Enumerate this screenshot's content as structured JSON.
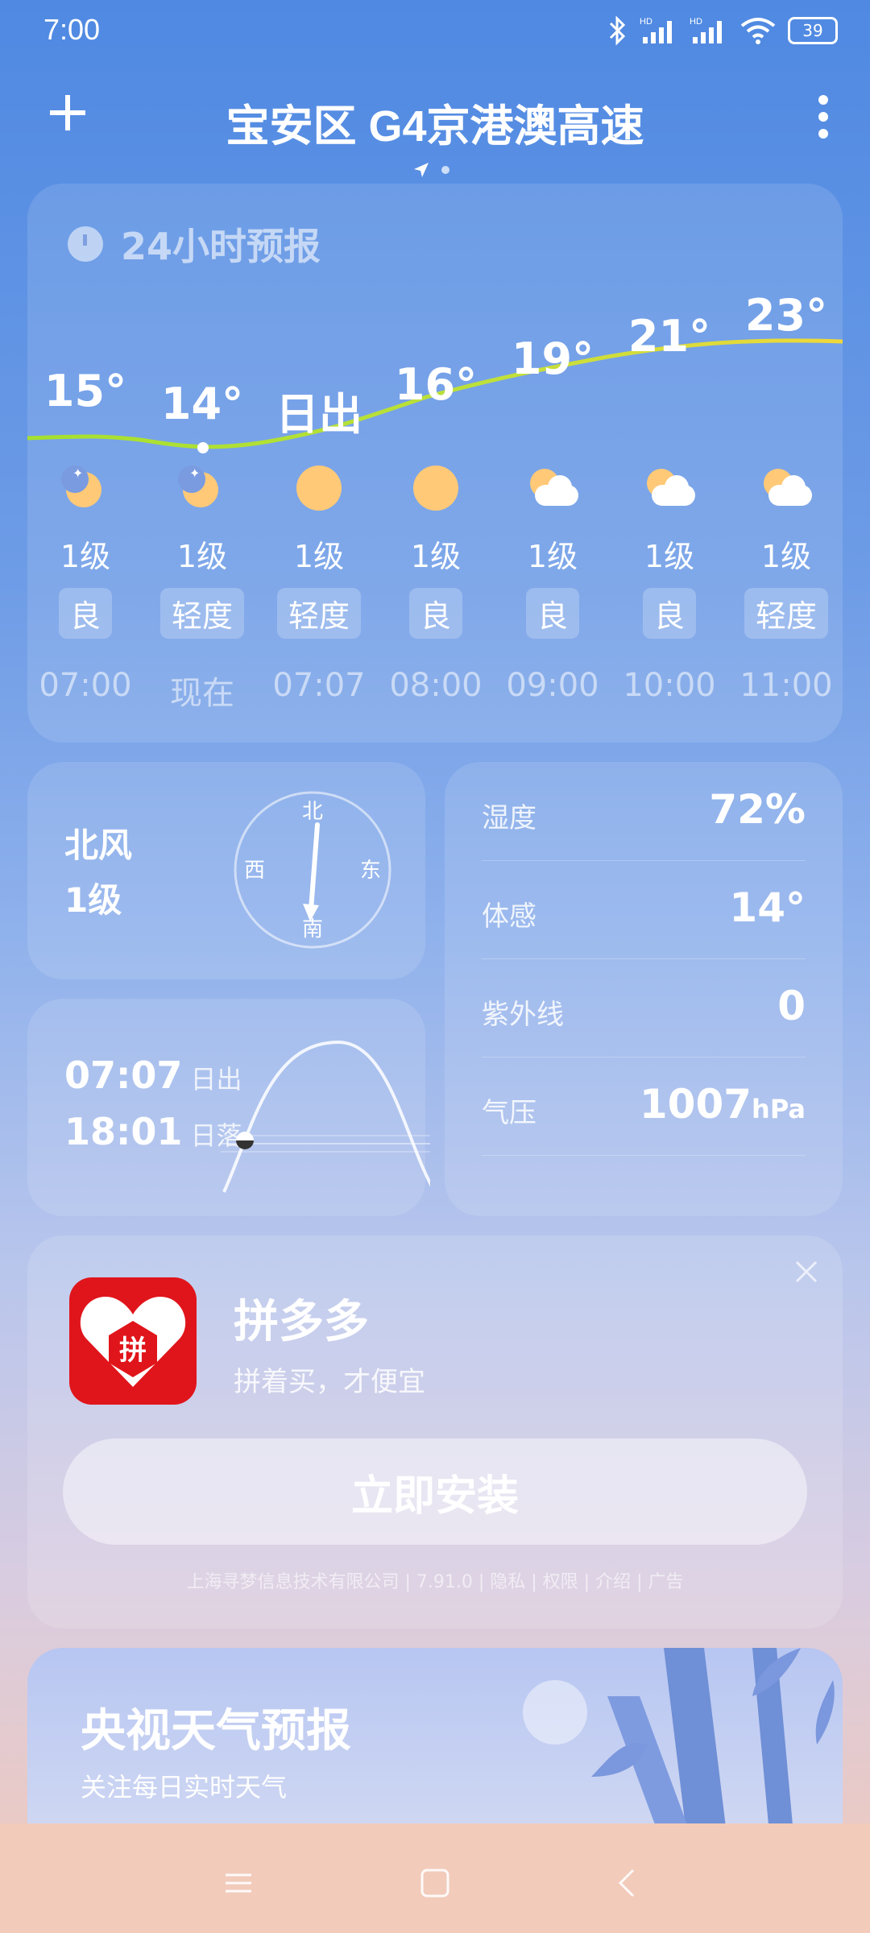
{
  "status_bar": {
    "time": "7:00",
    "battery": "39"
  },
  "header": {
    "location": "宝安区 G4京港澳高速"
  },
  "hourly": {
    "title": "24小时预报",
    "items": [
      {
        "temp": "15°",
        "weather": "moon",
        "wind": "1级",
        "aqi": "良",
        "hour": "07:00"
      },
      {
        "temp": "14°",
        "weather": "moon",
        "wind": "1级",
        "aqi": "轻度",
        "hour": "现在"
      },
      {
        "temp": "日出",
        "weather": "sun",
        "wind": "1级",
        "aqi": "轻度",
        "hour": "07:07"
      },
      {
        "temp": "16°",
        "weather": "sun",
        "wind": "1级",
        "aqi": "良",
        "hour": "08:00"
      },
      {
        "temp": "19°",
        "weather": "cloudy",
        "wind": "1级",
        "aqi": "良",
        "hour": "09:00"
      },
      {
        "temp": "21°",
        "weather": "cloudy",
        "wind": "1级",
        "aqi": "良",
        "hour": "10:00"
      },
      {
        "temp": "23°",
        "weather": "cloudy",
        "wind": "1级",
        "aqi": "轻度",
        "hour": "11:00"
      }
    ]
  },
  "wind": {
    "direction": "北风",
    "level": "1级",
    "compass": {
      "n": "北",
      "s": "南",
      "e": "东",
      "w": "西"
    }
  },
  "sun": {
    "sunrise_time": "07:07",
    "sunrise_label": "日出",
    "sunset_time": "18:01",
    "sunset_label": "日落"
  },
  "details": [
    {
      "key": "湿度",
      "value": "72%",
      "unit": ""
    },
    {
      "key": "体感",
      "value": "14°",
      "unit": ""
    },
    {
      "key": "紫外线",
      "value": "0",
      "unit": ""
    },
    {
      "key": "气压",
      "value": "1007",
      "unit": "hPa"
    }
  ],
  "ad": {
    "app_name": "拼多多",
    "logo_text": "拼",
    "slogan": "拼着买，才便宜",
    "install_label": "立即安装",
    "meta": "上海寻梦信息技术有限公司 | 7.91.0 | 隐私 | 权限 | 介绍 | 广告"
  },
  "cctv": {
    "title": "央视天气预报",
    "subtitle": "关注每日实时天气"
  },
  "colors": {
    "accent": "#4f89e2",
    "sun": "#ffc977",
    "pdd_red": "#e0151b",
    "curve_green": "#a5e02f",
    "curve_yellow": "#f0d83a"
  }
}
